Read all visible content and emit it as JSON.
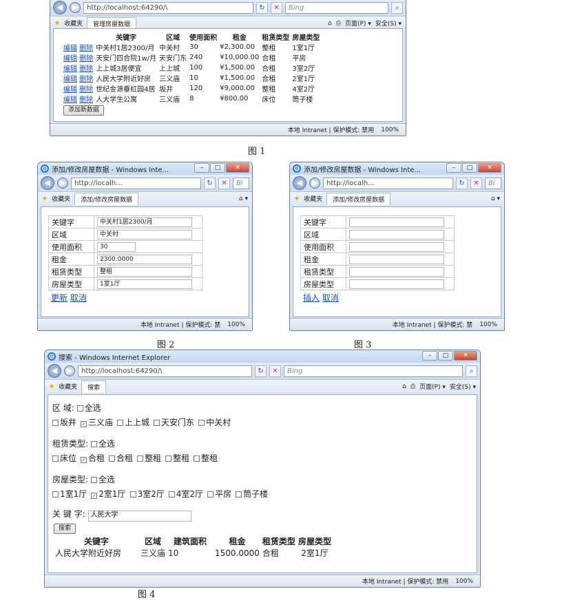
{
  "w1": {
    "url": "http://localhost:64290/\\",
    "search": "Bing",
    "tab": "管理房屋数据",
    "fav": "收藏夹",
    "menu_page": "页面(P) ▾",
    "menu_safe": "安全(S) ▾",
    "headers": [
      "关键字",
      "区域",
      "使用面积",
      "租金",
      "租赁类型",
      "房屋类型"
    ],
    "edit": "编辑",
    "del": "删除",
    "rows": [
      [
        "中关村1居2300/月",
        "中关村",
        "30",
        "¥2,300.00",
        "整租",
        "1室1厅"
      ],
      [
        "天安门四合院1w/月",
        "天安门东",
        "240",
        "¥10,000.00",
        "合租",
        "平房"
      ],
      [
        "上上城3居便宜",
        "上上城",
        "100",
        "¥1,500.00",
        "合租",
        "3室2厅"
      ],
      [
        "人民大学附近好房",
        "三义庙",
        "10",
        "¥1,500.00",
        "合租",
        "2室1厅"
      ],
      [
        "世纪金源垂虹园4居",
        "坂井",
        "120",
        "¥9,000.00",
        "整租",
        "4室2厅"
      ],
      [
        "人大学生公寓",
        "三义庙",
        "8",
        "¥800.00",
        "床位",
        "筒子楼"
      ]
    ],
    "add_btn": "添加新数据",
    "status": "本地 Intranet | 保护模式: 禁用",
    "zoom": "100%"
  },
  "cap1": "图 1",
  "w2": {
    "title": "添加/修改房屋数据 - Windows Inte...",
    "url": "http://localh...",
    "search": "Bi",
    "fav": "收藏夹",
    "tab": "添加/修改房屋数据",
    "fields": [
      {
        "label": "关键字",
        "value": "中关村1居2300/月"
      },
      {
        "label": "区域",
        "value": "中关村"
      },
      {
        "label": "使用面积",
        "value": "30"
      },
      {
        "label": "租金",
        "value": "2300.0000"
      },
      {
        "label": "租赁类型",
        "value": "整租"
      },
      {
        "label": "房屋类型",
        "value": "1室1厅"
      }
    ],
    "link1": "更新",
    "link2": "取消",
    "status": "本地 Intranet | 保护模式: 禁",
    "zoom": "100%"
  },
  "cap2": "图 2",
  "w3": {
    "title": "添加/修改房屋数据 - Windows Inte...",
    "url": "http://localh...",
    "search": "Bi",
    "fav": "收藏夹",
    "tab": "添加/修改房屋数据",
    "labels": [
      "关键字",
      "区域",
      "使用面积",
      "租金",
      "租赁类型",
      "房屋类型"
    ],
    "link1": "插入",
    "link2": "取消",
    "status": "本地 Intranet | 保护模式: 禁",
    "zoom": "100%"
  },
  "cap3": "图 3",
  "w4": {
    "title": "搜索 - Windows Internet Explorer",
    "url": "http://localhost:64290/\\",
    "search": "Bing",
    "fav": "收藏夹",
    "tab": "搜索",
    "menu_page": "页面(P) ▾",
    "menu_safe": "安全(S) ▾",
    "area_label": "区    域:",
    "all": "全选",
    "areas": [
      {
        "t": "坂井",
        "c": false
      },
      {
        "t": "三义庙",
        "c": true
      },
      {
        "t": "上上城",
        "c": false
      },
      {
        "t": "天安门东",
        "c": false
      },
      {
        "t": "中关村",
        "c": false
      }
    ],
    "rent_label": "租赁类型:",
    "rents": [
      {
        "t": "床位",
        "c": false
      },
      {
        "t": "合租",
        "c": true
      },
      {
        "t": "合租",
        "c": false
      },
      {
        "t": "整租",
        "c": false
      },
      {
        "t": "整租",
        "c": false
      },
      {
        "t": "整租",
        "c": false
      }
    ],
    "house_label": "房屋类型:",
    "houses": [
      {
        "t": "1室1厅",
        "c": false
      },
      {
        "t": "2室1厅",
        "c": true
      },
      {
        "t": "3室2厅",
        "c": false
      },
      {
        "t": "4室2厅",
        "c": false
      },
      {
        "t": "平房",
        "c": false
      },
      {
        "t": "筒子楼",
        "c": false
      }
    ],
    "kw_label": "关 键 字:",
    "kw_value": "人民大学",
    "search_btn": "搜索",
    "headers": [
      "关键字",
      "区域",
      "建筑面积",
      "租金",
      "租赁类型",
      "房屋类型"
    ],
    "result": [
      "人民大学附近好房",
      "三义庙",
      "10",
      "1500.0000",
      "合租",
      "2室1厅"
    ],
    "status": "本地 Intranet | 保护模式: 禁用",
    "zoom": "100%"
  },
  "cap4": "图 4"
}
